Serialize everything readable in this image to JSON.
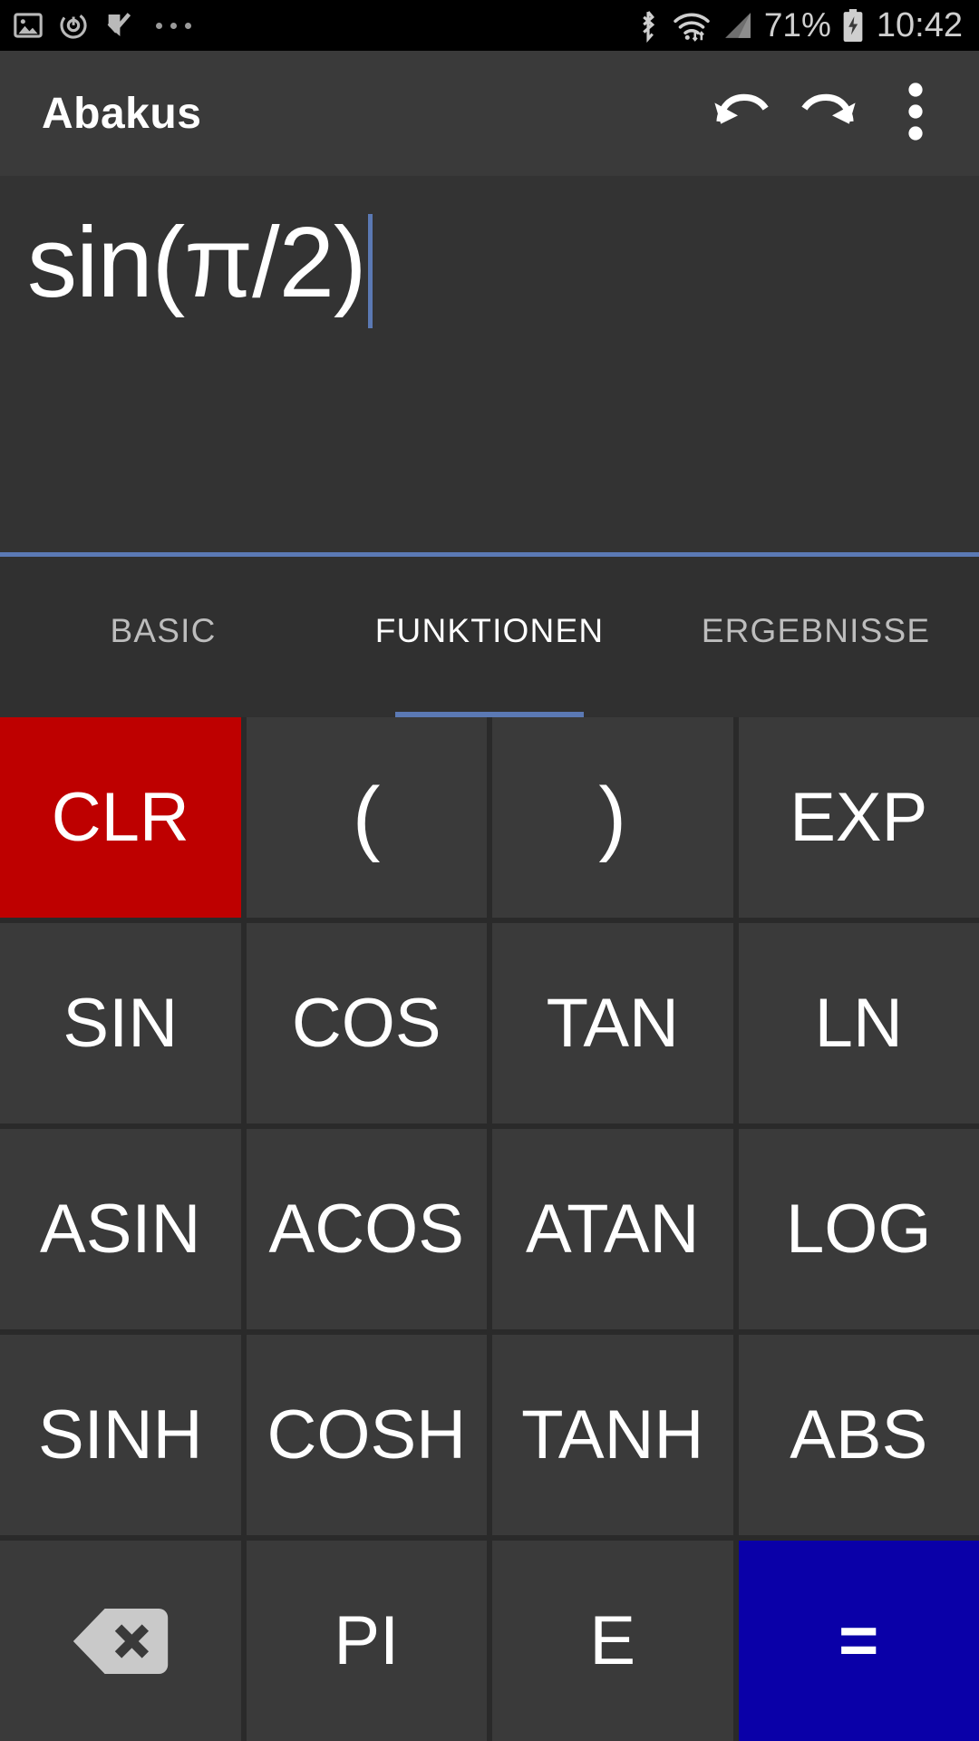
{
  "status_bar": {
    "left_icons": [
      "image-icon",
      "timer-icon",
      "tasks-check-icon",
      "more-dots-icon"
    ],
    "right_icons": [
      "bluetooth-icon",
      "wifi-icon",
      "cellular-signal-icon",
      "battery-charging-icon"
    ],
    "battery_percent": "71%",
    "clock": "10:42"
  },
  "app_bar": {
    "title": "Abakus",
    "undo_label": "undo-icon",
    "redo_label": "redo-icon",
    "overflow_label": "overflow-menu-icon"
  },
  "display": {
    "expression": "sin(π/2)",
    "cursor_visible": true,
    "accent_color": "#5b79b4"
  },
  "tabs": [
    {
      "label": "BASIC",
      "active": false
    },
    {
      "label": "FUNKTIONEN",
      "active": true
    },
    {
      "label": "ERGEBNISSE",
      "active": false
    }
  ],
  "keypad": {
    "rows": [
      [
        {
          "label": "CLR",
          "style": "clr",
          "icon": null
        },
        {
          "label": "(",
          "style": "paren",
          "icon": null
        },
        {
          "label": ")",
          "style": "paren",
          "icon": null
        },
        {
          "label": "EXP",
          "style": "",
          "icon": null
        }
      ],
      [
        {
          "label": "SIN",
          "style": "",
          "icon": null
        },
        {
          "label": "COS",
          "style": "",
          "icon": null
        },
        {
          "label": "TAN",
          "style": "",
          "icon": null
        },
        {
          "label": "LN",
          "style": "",
          "icon": null
        }
      ],
      [
        {
          "label": "ASIN",
          "style": "",
          "icon": null
        },
        {
          "label": "ACOS",
          "style": "",
          "icon": null
        },
        {
          "label": "ATAN",
          "style": "",
          "icon": null
        },
        {
          "label": "LOG",
          "style": "",
          "icon": null
        }
      ],
      [
        {
          "label": "SINH",
          "style": "",
          "icon": null
        },
        {
          "label": "COSH",
          "style": "",
          "icon": null
        },
        {
          "label": "TANH",
          "style": "",
          "icon": null
        },
        {
          "label": "ABS",
          "style": "",
          "icon": null
        }
      ],
      [
        {
          "label": "",
          "style": "",
          "icon": "backspace-icon"
        },
        {
          "label": "PI",
          "style": "",
          "icon": null
        },
        {
          "label": "E",
          "style": "",
          "icon": null
        },
        {
          "label": "=",
          "style": "equals",
          "icon": null
        }
      ]
    ]
  },
  "colors": {
    "accent": "#5b79b4",
    "clear_red": "#be0000",
    "equals_blue": "#0a00a8",
    "key_bg": "#3a3a3a",
    "app_bar_bg": "#3a3a3a",
    "display_bg": "#333333"
  }
}
